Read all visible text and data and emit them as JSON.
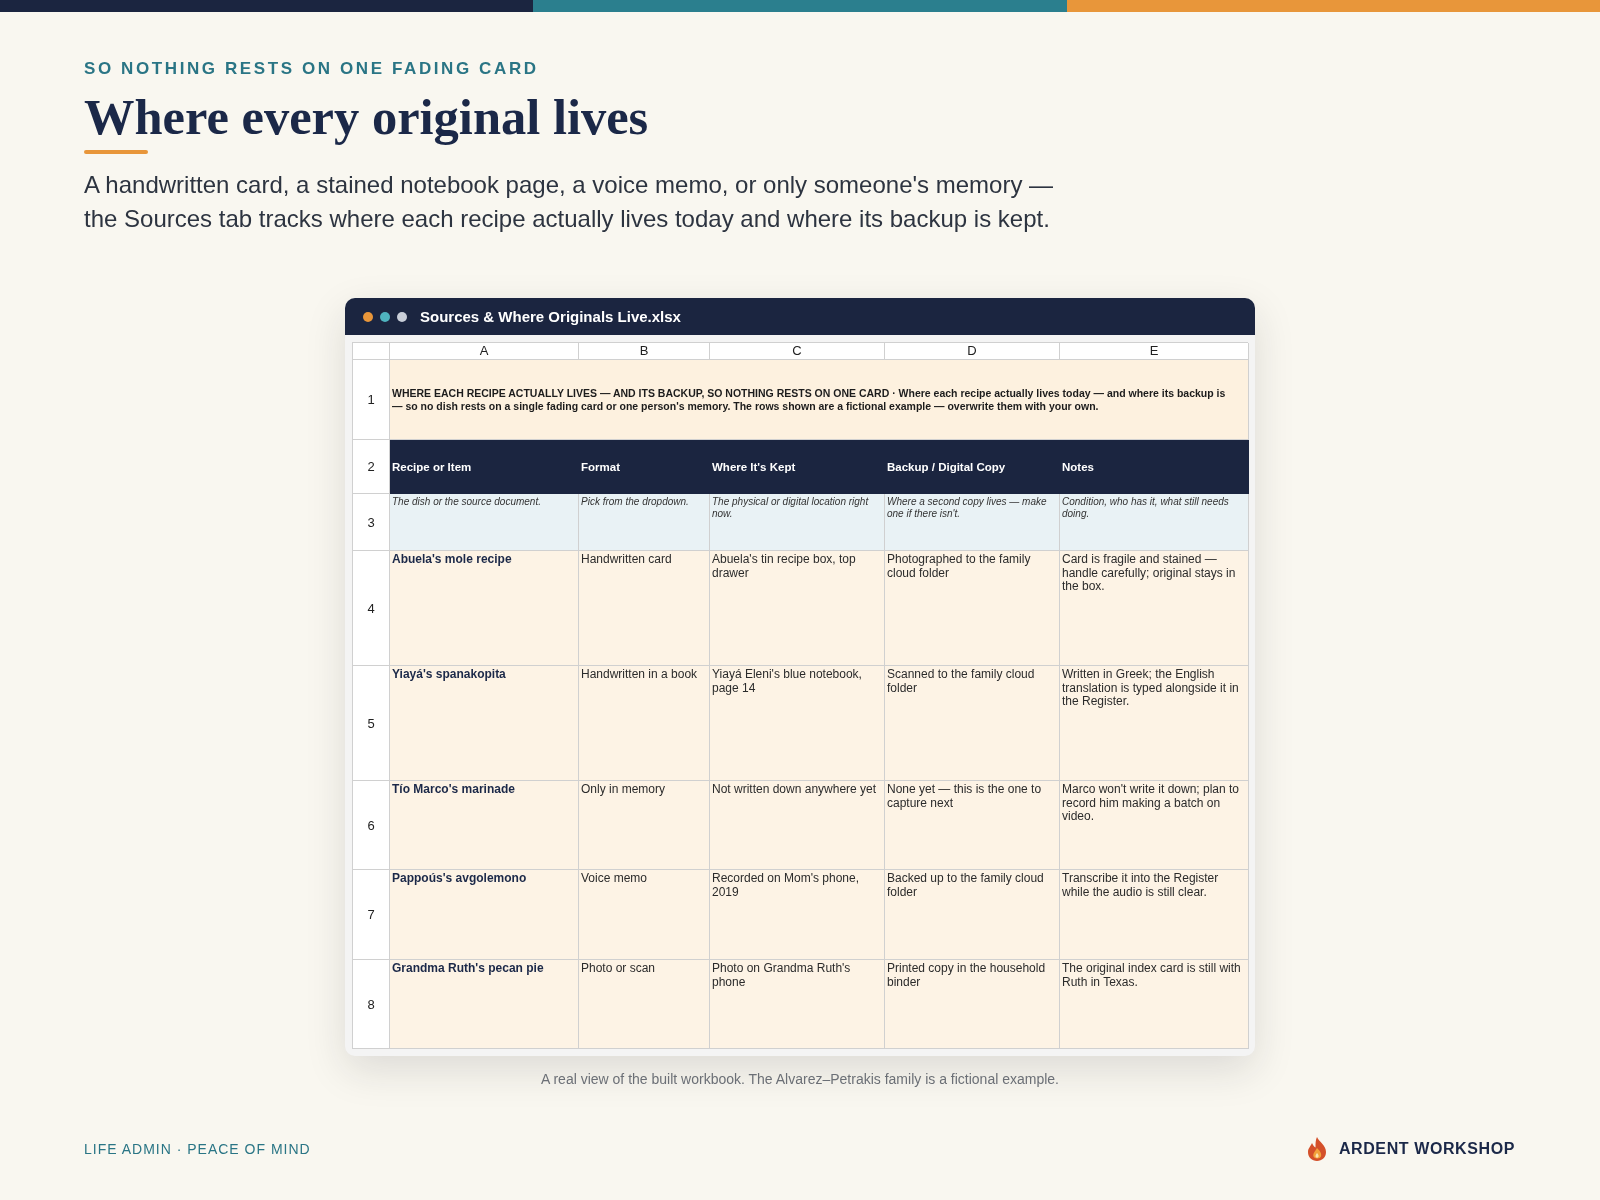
{
  "header": {
    "eyebrow": "SO NOTHING RESTS ON ONE FADING CARD",
    "title": "Where every original lives",
    "intro": "A handwritten card, a stained notebook page, a voice memo, or only someone's memory — the Sources tab tracks where each recipe actually lives today and where its backup is kept."
  },
  "workbook": {
    "title": "Sources & Where Originals Live.xlsx",
    "columns": [
      "A",
      "B",
      "C",
      "D",
      "E"
    ],
    "rows": [
      {
        "number": "1",
        "kind": "banner",
        "cells": [
          "WHERE EACH RECIPE ACTUALLY LIVES — AND ITS BACKUP, SO NOTHING RESTS ON ONE CARD · Where each recipe actually lives today — and where its backup is — so no dish rests on a single fading card or one person's memory. The rows shown are a fictional example — overwrite them with your own."
        ]
      },
      {
        "number": "2",
        "kind": "header",
        "cells": [
          "Recipe or Item",
          "Format",
          "Where It's Kept",
          "Backup / Digital Copy",
          "Notes"
        ]
      },
      {
        "number": "3",
        "kind": "hint",
        "cells": [
          "The dish or the source document.",
          "Pick from the dropdown.",
          "The physical or digital location right now.",
          "Where a second copy lives — make one if there isn't.",
          "Condition, who has it, what still needs doing."
        ]
      },
      {
        "number": "4",
        "kind": "data",
        "cells": [
          "Abuela's mole recipe",
          "Handwritten card",
          "Abuela's tin recipe box, top drawer",
          "Photographed to the family cloud folder",
          "Card is fragile and stained — handle carefully; original stays in the box."
        ]
      },
      {
        "number": "5",
        "kind": "data",
        "cells": [
          "Yiayá's spanakopita",
          "Handwritten in a book",
          "Yiayá Eleni's blue notebook, page 14",
          "Scanned to the family cloud folder",
          "Written in Greek; the English translation is typed alongside it in the Register."
        ]
      },
      {
        "number": "6",
        "kind": "data",
        "cells": [
          "Tío Marco's marinade",
          "Only in memory",
          "Not written down anywhere yet",
          "None yet — this is the one to capture next",
          "Marco won't write it down; plan to record him making a batch on video."
        ]
      },
      {
        "number": "7",
        "kind": "data",
        "cells": [
          "Pappoús's avgolemono",
          "Voice memo",
          "Recorded on Mom's phone, 2019",
          "Backed up to the family cloud folder",
          "Transcribe it into the Register while the audio is still clear."
        ]
      },
      {
        "number": "8",
        "kind": "data",
        "cells": [
          "Grandma Ruth's pecan pie",
          "Photo or scan",
          "Photo on Grandma Ruth's phone",
          "Printed copy in the household binder",
          "The original index card is still with Ruth in Texas."
        ]
      }
    ]
  },
  "caption": "A real view of the built workbook. The Alvarez–Petrakis family is a fictional example.",
  "footer": {
    "tagline": "LIFE ADMIN · PEACE OF MIND",
    "brand": "ARDENT WORKSHOP"
  }
}
